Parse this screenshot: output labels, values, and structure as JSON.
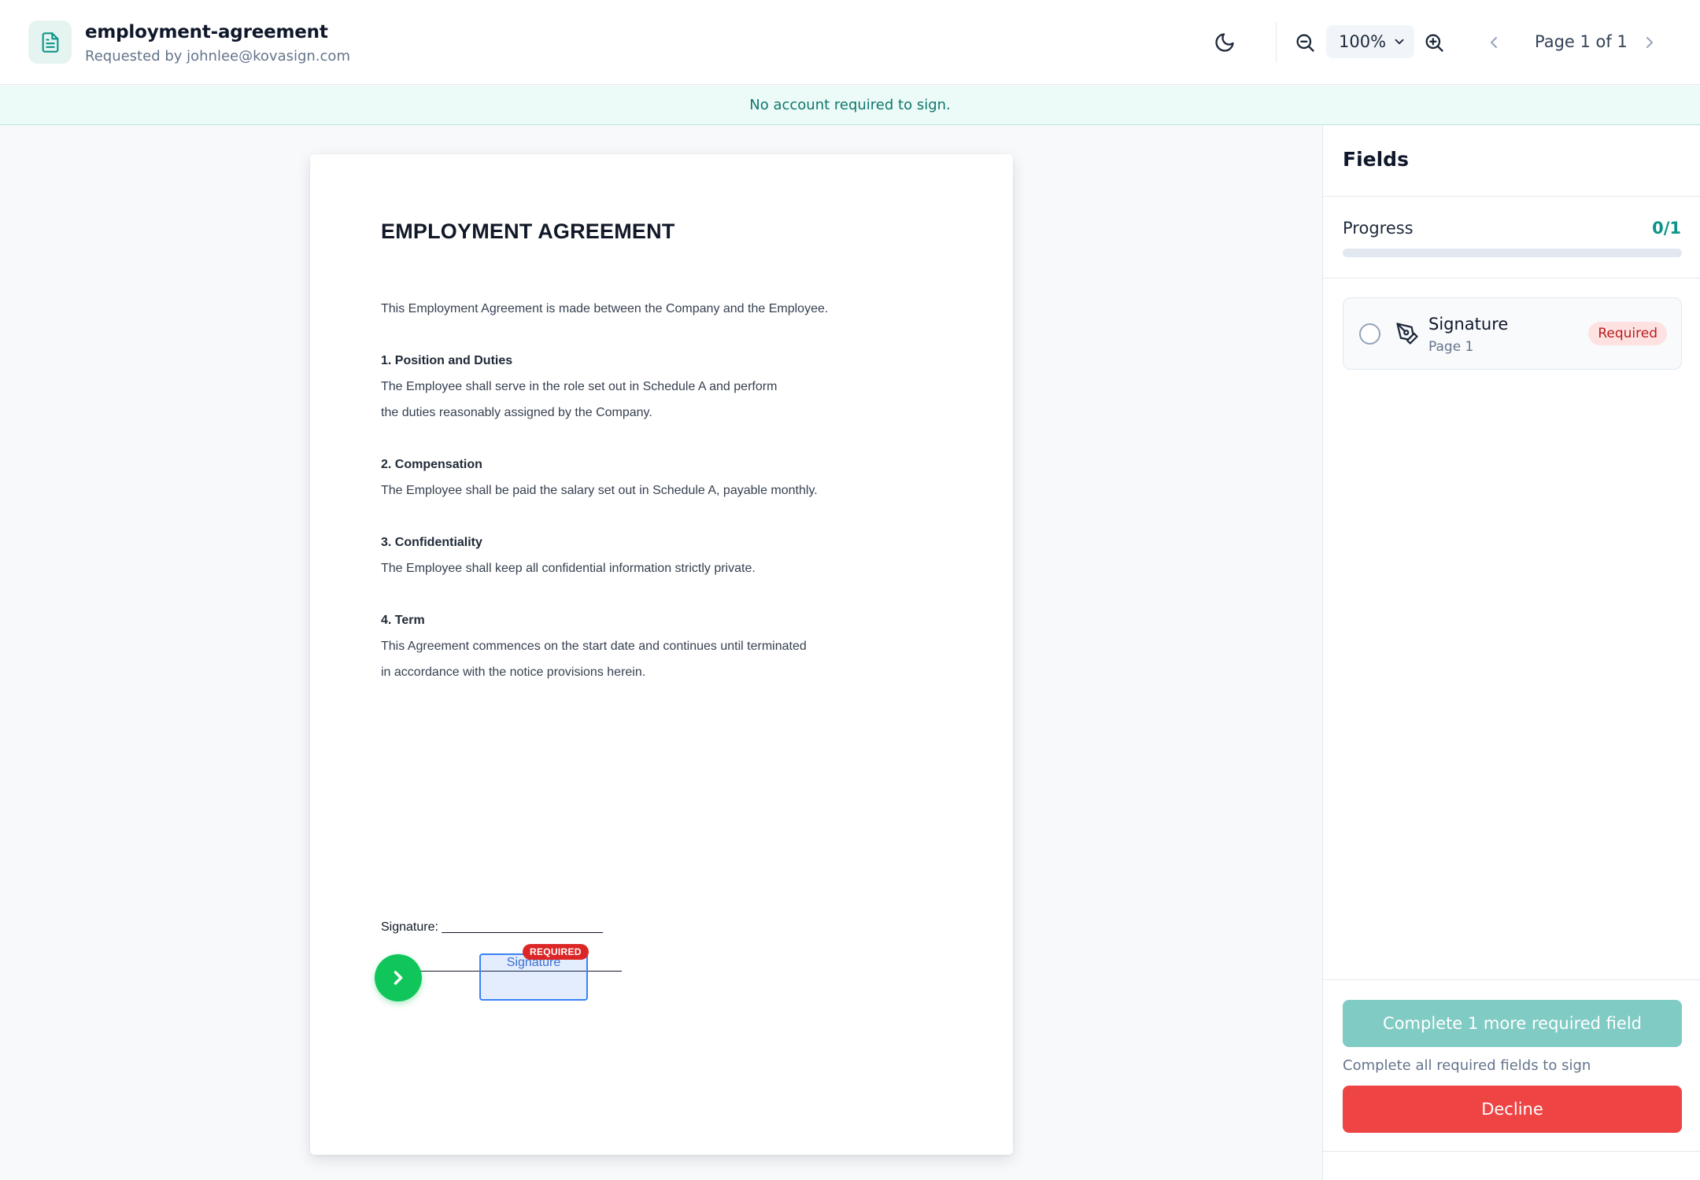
{
  "header": {
    "doc_title": "employment-agreement",
    "requested_by": "Requested by johnlee@kovasign.com",
    "zoom_value": "100%",
    "page_indicator": "Page 1 of 1",
    "icons": [
      "document-icon",
      "moon-icon",
      "zoom-out-icon",
      "chevron-down-icon",
      "zoom-in-icon",
      "chevron-left-icon",
      "chevron-right-icon"
    ]
  },
  "banner": {
    "text": "No account required to sign."
  },
  "document": {
    "title": "EMPLOYMENT AGREEMENT",
    "intro": "This Employment Agreement is made between the Company and the Employee.",
    "sections": [
      {
        "heading": "1. Position and Duties",
        "lines": [
          "The Employee shall serve in the role set out in Schedule A and perform",
          "the duties reasonably assigned by the Company."
        ]
      },
      {
        "heading": "2. Compensation",
        "lines": [
          "The Employee shall be paid the salary set out in Schedule A, payable monthly."
        ]
      },
      {
        "heading": "3. Confidentiality",
        "lines": [
          "The Employee shall keep all confidential information strictly private."
        ]
      },
      {
        "heading": "4. Term",
        "lines": [
          "This Agreement commences on the start date and continues until terminated",
          "in accordance with the notice provisions herein."
        ]
      }
    ],
    "signature_line": "Signature: _______________________",
    "signature_field_label": "Signature",
    "required_tag": "REQUIRED"
  },
  "sidebar": {
    "title": "Fields",
    "progress_label": "Progress",
    "progress_count": "0/1",
    "progress_fraction": 0,
    "fields": [
      {
        "name": "Signature",
        "page": "Page 1",
        "badge": "Required",
        "icon": "pen-icon"
      }
    ],
    "complete_button": "Complete 1 more required field",
    "complete_hint": "Complete all required fields to sign",
    "decline_button": "Decline"
  },
  "colors": {
    "accent": "#0d9488",
    "banner_bg": "#ecfbf7",
    "required_red": "#dc2626",
    "decline_red": "#ef4444",
    "go_green": "#10c65b",
    "field_blue": "#3b82f6"
  }
}
